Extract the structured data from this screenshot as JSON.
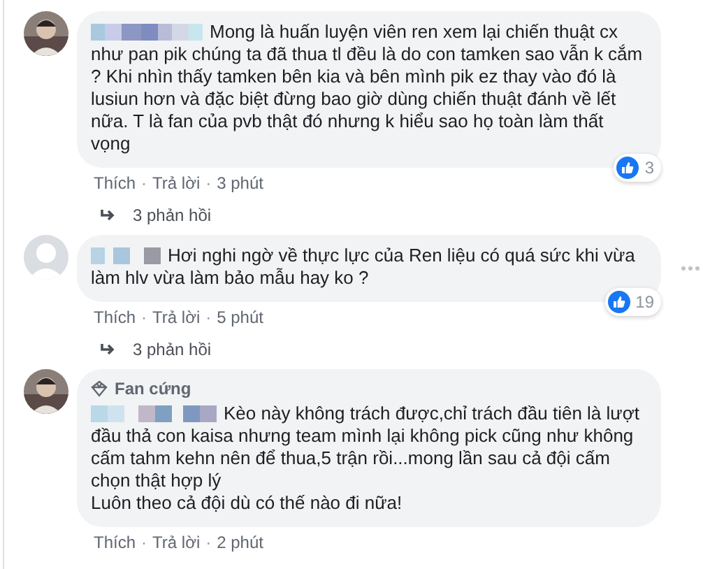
{
  "comments": [
    {
      "avatar": {
        "kind": "photo"
      },
      "text": "Mong là huấn luyện viên ren xem lại chiến thuật cx như pan pik chúng ta đã thua tl đều là do con tamken sao vẫn k cắm ? Khi nhìn thấy tamken bên kia và bên mình pik ez thay vào đó là lusiun hơn và đặc biệt đừng bao giờ dùng chiến thuật đánh về lết nữa. T là fan của pvb thật đó nhưng k hiểu sao họ toàn làm thất vọng",
      "reaction_count": "3",
      "actions": [
        {
          "kind": "link",
          "text": "Thích"
        },
        {
          "kind": "dot",
          "text": "·"
        },
        {
          "kind": "link",
          "text": "Trả lời"
        },
        {
          "kind": "dot",
          "text": "·"
        },
        {
          "kind": "link",
          "text": "3 phút"
        }
      ],
      "replies": "3 phản hồi",
      "menu_shown": false
    },
    {
      "avatar": {
        "kind": "default"
      },
      "text": "Hơi nghi ngờ về thực lực của Ren liệu có quá sức khi vừa làm hlv vừa làm bảo mẫu hay ko ?",
      "reaction_count": "19",
      "actions": [
        {
          "kind": "link",
          "text": "Thích"
        },
        {
          "kind": "dot",
          "text": "·"
        },
        {
          "kind": "link",
          "text": "Trả lời"
        },
        {
          "kind": "dot",
          "text": "·"
        },
        {
          "kind": "link",
          "text": "5 phút"
        }
      ],
      "replies": "3 phản hồi",
      "menu_shown": true
    },
    {
      "avatar": {
        "kind": "photo"
      },
      "badge": "Fan cứng",
      "text": "Kèo này không trách được,chỉ trách đầu tiên là lượt đầu thả con kaisa nhưng team mình lại không pick cũng như không cấm tahm kehn nên để thua,5 trận rồi...mong lần sau cả đội cấm chọn thật hợp lý\nLuôn theo cả đội dù có thế nào đi nữa!",
      "actions": [
        {
          "kind": "link",
          "text": "Thích"
        },
        {
          "kind": "dot",
          "text": "·"
        },
        {
          "kind": "link",
          "text": "Trả lời"
        },
        {
          "kind": "dot",
          "text": "·"
        },
        {
          "kind": "link",
          "text": "2 phút"
        }
      ],
      "menu_shown": false
    }
  ]
}
